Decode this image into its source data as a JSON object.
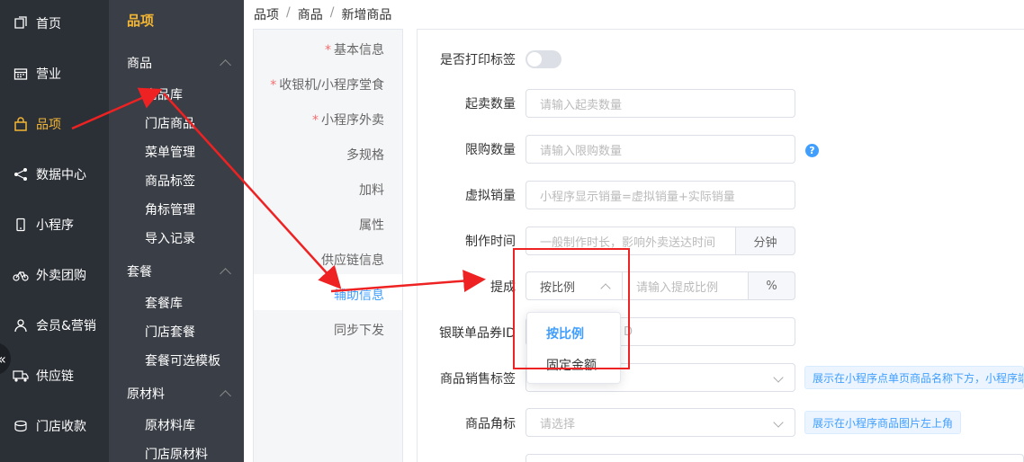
{
  "main_nav": [
    {
      "label": "首页",
      "icon": "home-icon"
    },
    {
      "label": "营业",
      "icon": "calendar-icon"
    },
    {
      "label": "品项",
      "icon": "bag-icon",
      "active": true
    },
    {
      "label": "数据中心",
      "icon": "share-icon"
    },
    {
      "label": "小程序",
      "icon": "phone-icon"
    },
    {
      "label": "外卖团购",
      "icon": "bike-icon"
    },
    {
      "label": "会员&营销",
      "icon": "user-icon"
    },
    {
      "label": "供应链",
      "icon": "truck-icon"
    },
    {
      "label": "门店收款",
      "icon": "coin-icon"
    }
  ],
  "collapse_glyph": "«",
  "sub_nav": {
    "title": "品项",
    "groups": [
      {
        "label": "商品",
        "items": [
          "商品库",
          "门店商品",
          "菜单管理",
          "商品标签",
          "角标管理",
          "导入记录"
        ]
      },
      {
        "label": "套餐",
        "items": [
          "套餐库",
          "门店套餐",
          "套餐可选模板"
        ]
      },
      {
        "label": "原材料",
        "items": [
          "原材料库",
          "门店原材料"
        ]
      }
    ]
  },
  "breadcrumb": [
    "品项",
    "商品",
    "新增商品"
  ],
  "breadcrumb_sep": "/",
  "tabs": [
    {
      "label": "基本信息",
      "required": true
    },
    {
      "label": "收银机/小程序堂食",
      "required": true
    },
    {
      "label": "小程序外卖",
      "required": true
    },
    {
      "label": "多规格",
      "required": false
    },
    {
      "label": "加料",
      "required": false
    },
    {
      "label": "属性",
      "required": false
    },
    {
      "label": "供应链信息",
      "required": false
    },
    {
      "label": "辅助信息",
      "required": false,
      "active": true
    },
    {
      "label": "同步下发",
      "required": false
    }
  ],
  "required_mark": "*",
  "form": {
    "print_label": "是否打印标签",
    "print_on": false,
    "min_qty_label": "起卖数量",
    "min_qty_placeholder": "请输入起卖数量",
    "limit_label": "限购数量",
    "limit_placeholder": "请输入限购数量",
    "help_glyph": "?",
    "virtual_sales_label": "虚拟销量",
    "virtual_sales_placeholder": "小程序显示销量=虚拟销量+实际销量",
    "make_time_label": "制作时间",
    "make_time_placeholder": "一般制作时长，影响外卖送达时间",
    "make_time_unit": "分钟",
    "commission_label": "提成",
    "commission_mode": "按比例",
    "commission_placeholder": "请输入提成比例",
    "commission_unit": "%",
    "unionpay_label": "银联单品券ID",
    "unionpay_placeholder_visible": "D",
    "sale_tag_label": "商品销售标签",
    "sale_tag_tip": "展示在小程序点单页商品名称下方，小程序端",
    "corner_label": "商品角标",
    "corner_placeholder": "请选择",
    "corner_tip": "展示在小程序商品图片左上角"
  },
  "dropdown_options": [
    {
      "label": "按比例",
      "selected": true
    },
    {
      "label": "固定金额",
      "selected": false
    }
  ],
  "colors": {
    "sidebar": "#2b2f36",
    "subsidebar": "#3a3e46",
    "accent": "#f3b634",
    "primary": "#409eff",
    "annotation": "#e22222"
  }
}
